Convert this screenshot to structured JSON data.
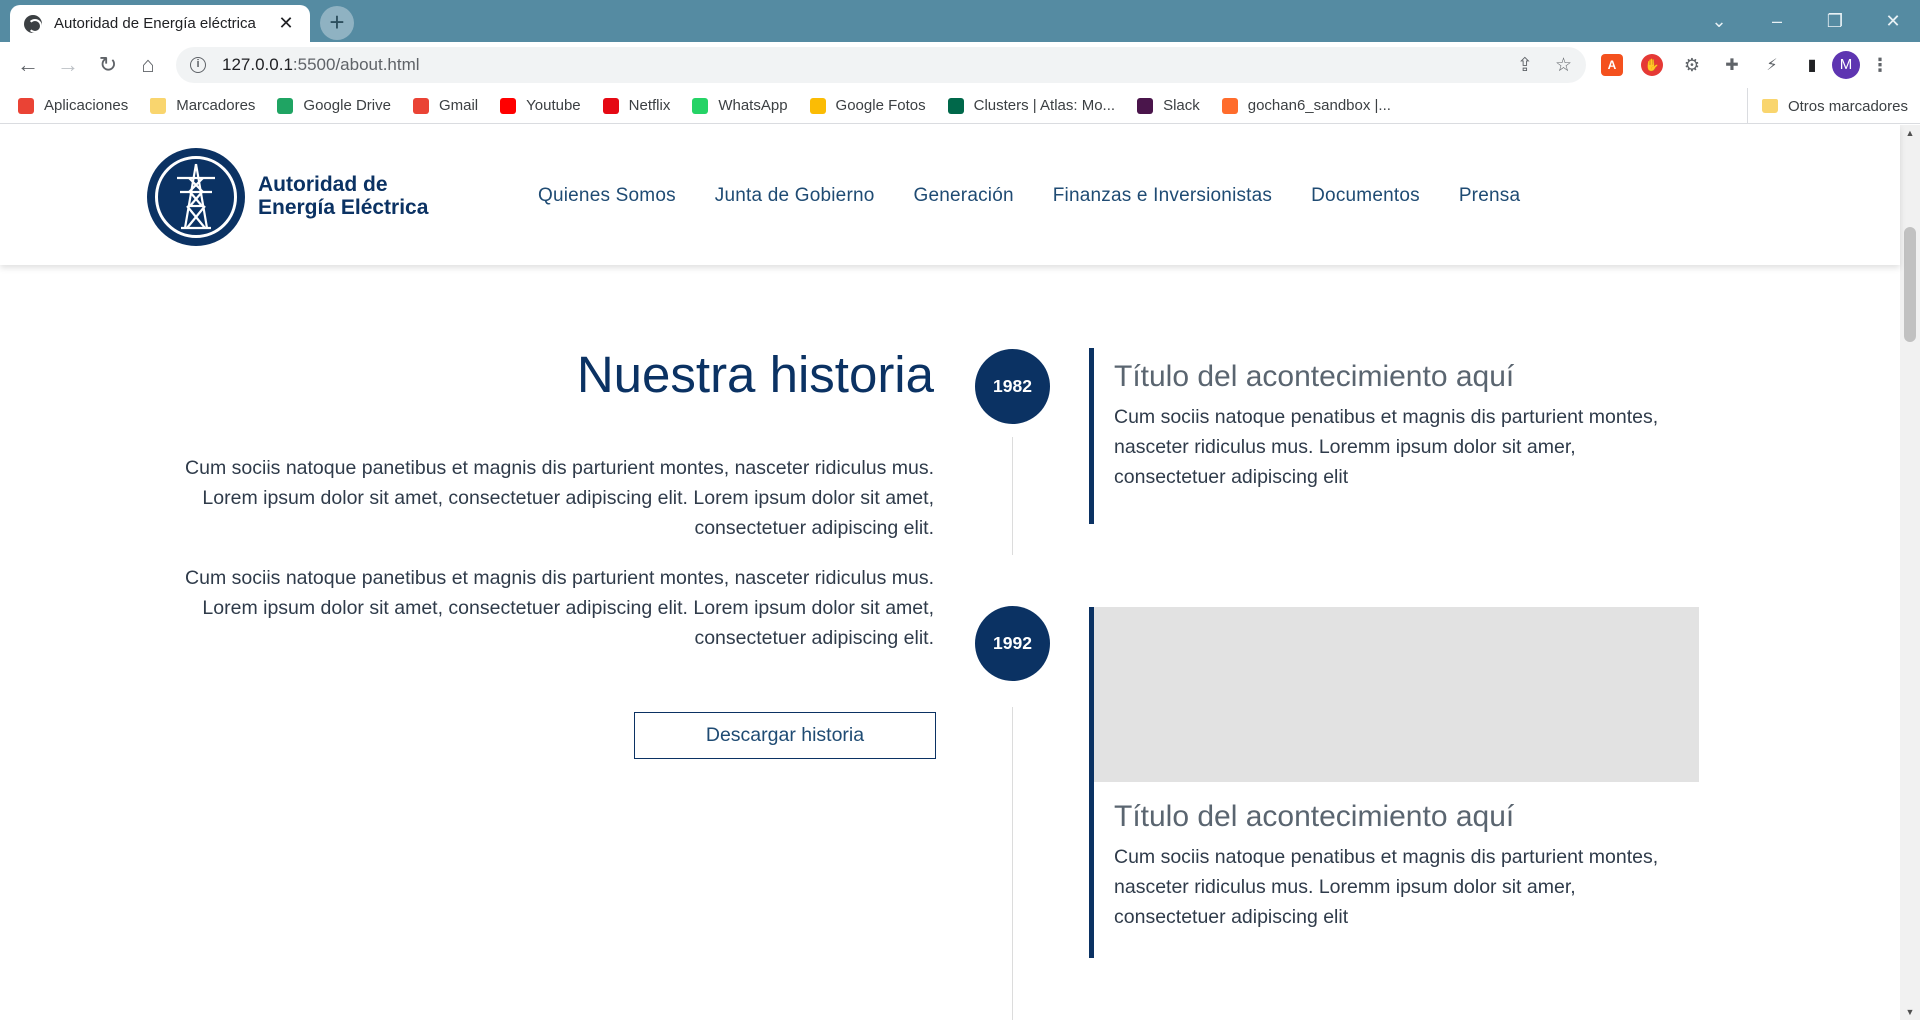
{
  "browser": {
    "tab_title": "Autoridad de Energía eléctrica",
    "tab_close": "✕",
    "new_tab": "+",
    "url_host": "127.0.0.1",
    "url_path": ":5500/about.html",
    "avatar_letter": "M",
    "bookmarks": [
      {
        "label": "Aplicaciones",
        "icon": "apps-grid-icon",
        "color": "#ea4335"
      },
      {
        "label": "Marcadores",
        "icon": "folder-icon",
        "color": "#f9d56e"
      },
      {
        "label": "Google Drive",
        "icon": "google-drive-icon",
        "color": "#1fa463"
      },
      {
        "label": "Gmail",
        "icon": "gmail-icon",
        "color": "#ea4335"
      },
      {
        "label": "Youtube",
        "icon": "youtube-icon",
        "color": "#ff0000"
      },
      {
        "label": "Netflix",
        "icon": "netflix-icon",
        "color": "#e50914"
      },
      {
        "label": "WhatsApp",
        "icon": "whatsapp-icon",
        "color": "#25d366"
      },
      {
        "label": "Google Fotos",
        "icon": "google-photos-icon",
        "color": "#fbbc04"
      },
      {
        "label": "Clusters | Atlas: Mo...",
        "icon": "mongodb-icon",
        "color": "#00684a"
      },
      {
        "label": "Slack",
        "icon": "slack-icon",
        "color": "#4a154b"
      },
      {
        "label": "gochan6_sandbox |...",
        "icon": "cpanel-icon",
        "color": "#ff6c2c"
      }
    ],
    "other_bookmarks": "Otros marcadores"
  },
  "site": {
    "brand_line1": "Autoridad de",
    "brand_line2": "Energía Eléctrica",
    "nav": [
      "Quienes Somos",
      "Junta de Gobierno",
      "Generación",
      "Finanzas e Inversionistas",
      "Documentos",
      "Prensa"
    ]
  },
  "history": {
    "title": "Nuestra historia",
    "paragraphs": [
      "Cum sociis natoque panetibus et magnis dis parturient montes, nasceter ridiculus mus. Lorem ipsum dolor sit amet, consectetuer adipiscing elit. Lorem ipsum dolor sit amet, consectetuer adipiscing elit.",
      "Cum sociis natoque panetibus et magnis dis parturient montes, nasceter ridiculus mus. Lorem ipsum dolor sit amet, consectetuer adipiscing elit. Lorem ipsum dolor sit amet, consectetuer adipiscing elit."
    ],
    "download_label": "Descargar historia"
  },
  "timeline": [
    {
      "year": "1982",
      "title": "Título del acontecimiento aquí",
      "text": "Cum sociis natoque penatibus et magnis dis parturient montes, nasceter ridiculus mus. Loremm ipsum dolor sit amer, consectetuer adipiscing elit"
    },
    {
      "year": "1992",
      "title": "Título del acontecimiento aquí",
      "text": "Cum sociis natoque penatibus et magnis dis parturient montes, nasceter ridiculus mus. Loremm ipsum dolor sit amer, consectetuer adipiscing elit"
    }
  ],
  "colors": {
    "brand_navy": "#0b3263",
    "tab_strip": "#558ba2",
    "image_placeholder": "#e2e2e2"
  }
}
